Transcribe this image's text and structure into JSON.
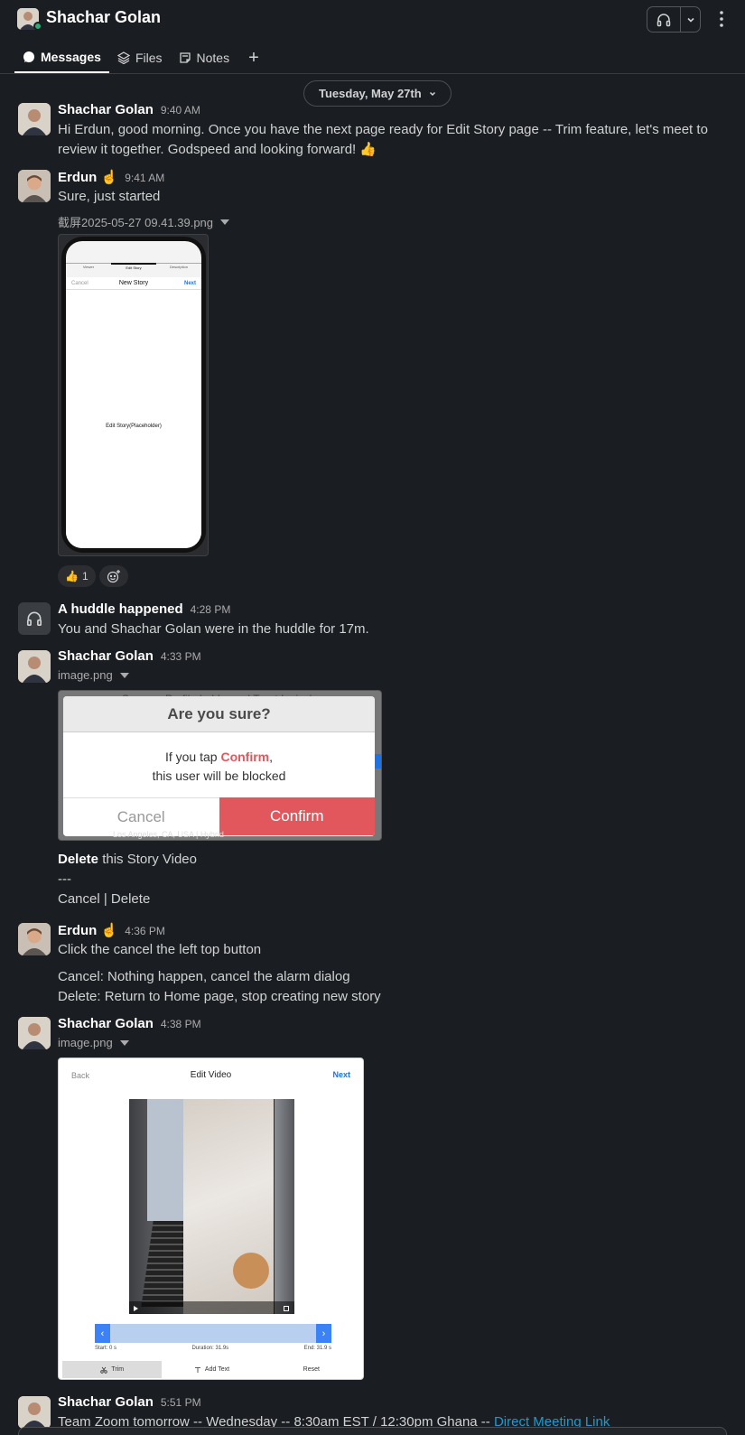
{
  "header": {
    "title": "Shachar Golan",
    "tabs": [
      {
        "label": "Messages",
        "icon": "chat-bubble-icon"
      },
      {
        "label": "Files",
        "icon": "layers-icon"
      },
      {
        "label": "Notes",
        "icon": "note-icon"
      }
    ],
    "add_tab": "+"
  },
  "date_divider": "Tuesday, May 27th",
  "messages": [
    {
      "sender": "Shachar Golan",
      "time": "9:40 AM",
      "lines": [
        "Hi Erdun, good morning. Once you have the next page ready for Edit Story page -- Trim feature, let's meet to",
        "review it together. Godspeed and looking forward! 👍"
      ]
    },
    {
      "sender": "Erdun ☝️",
      "time": "9:41 AM",
      "text": "Sure, just started",
      "file": "截屏2025-05-27 09.41.39.png",
      "reaction_count": "1"
    },
    {
      "sender": "A huddle happened",
      "time": "4:28 PM",
      "text": "You and Shachar Golan were in the huddle for 17m."
    },
    {
      "sender": "Shachar Golan",
      "time": "4:33 PM",
      "file": "image.png",
      "lines": [
        "this Story Video",
        "---",
        "Cancel | Delete"
      ],
      "bold_word": "Delete"
    },
    {
      "sender": "Erdun ☝️",
      "time": "4:36 PM",
      "lines": [
        "Click the cancel the left top button",
        "Cancel: Nothing happen, cancel the alarm dialog",
        "Delete: Return to Home page, stop creating new story"
      ]
    },
    {
      "sender": "Shachar Golan",
      "time": "4:38 PM",
      "file": "image.png"
    },
    {
      "sender": "Shachar Golan",
      "time": "5:51 PM",
      "text": "Team Zoom tomorrow -- Wednesday -- 8:30am EST / 12:30pm Ghana -- ",
      "link": "Direct Meeting Link"
    }
  ],
  "phone_image": {
    "tabs": [
      "Viewer",
      "Edit Story",
      "Description"
    ],
    "nav_left": "Cancel",
    "nav_title": "New Story",
    "nav_right": "Next",
    "placeholder": "Edit Story(Placeholder)"
  },
  "dialog_image": {
    "bg_text": "Sponsor Profile-hobbs and Trout Lyrical",
    "title": "Are you sure?",
    "body_prefix": "If you tap ",
    "body_emph": "Confirm",
    "body_suffix": ",",
    "body_line2": "this user will be blocked",
    "cancel": "Cancel",
    "confirm": "Confirm",
    "footer": "Los Angeles, CA, USA | Hybrid"
  },
  "edit_image": {
    "back": "Back",
    "title": "Edit Video",
    "next": "Next",
    "start": "Start: 0 s",
    "duration": "Duration: 31.9s",
    "end": "End: 31.9 s",
    "trim": "Trim",
    "add_text": "Add Text",
    "reset": "Reset"
  },
  "colors": {
    "background": "#1a1d21",
    "link": "#1d9bd1",
    "confirm_red": "#e2575c",
    "presence": "#2bac76"
  }
}
